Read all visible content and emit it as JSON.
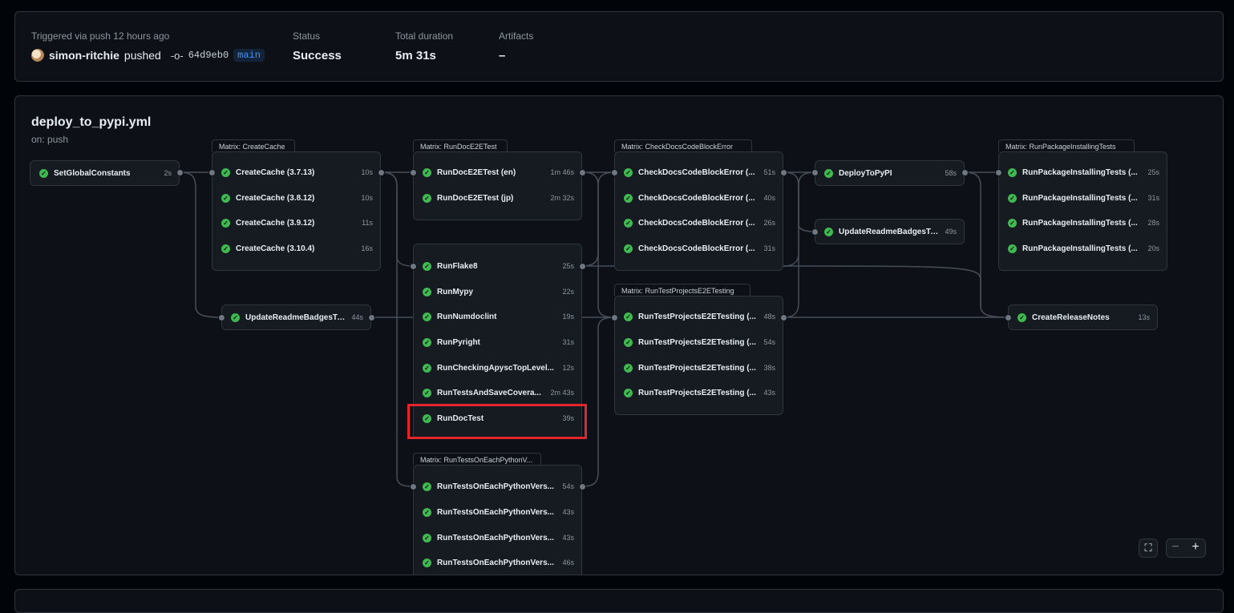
{
  "summary": {
    "trigger_label": "Triggered via push 12 hours ago",
    "actor": "simon-ritchie",
    "verb": "pushed",
    "commit_sha": "64d9eb0",
    "branch": "main",
    "status_label": "Status",
    "status_value": "Success",
    "duration_label": "Total duration",
    "duration_value": "5m 31s",
    "artifacts_label": "Artifacts",
    "artifacts_value": "–"
  },
  "workflow": {
    "file": "deploy_to_pypi.yml",
    "trigger": "on: push"
  },
  "groups": {
    "createcache": "Matrix: CreateCache",
    "rundoc": "Matrix: RunDocE2ETest",
    "checkdocs": "Matrix: CheckDocsCodeBlockError",
    "runpackage": "Matrix: RunPackageInstallingTests",
    "runtestprojects": "Matrix: RunTestProjectsE2ETesting",
    "runtestsonpy": "Matrix: RunTestsOnEachPythonV..."
  },
  "jobs": {
    "setglobal": {
      "name": "SetGlobalConstants",
      "dur": "2s"
    },
    "cc1": {
      "name": "CreateCache (3.7.13)",
      "dur": "10s"
    },
    "cc2": {
      "name": "CreateCache (3.8.12)",
      "dur": "10s"
    },
    "cc3": {
      "name": "CreateCache (3.9.12)",
      "dur": "11s"
    },
    "cc4": {
      "name": "CreateCache (3.10.4)",
      "dur": "16s"
    },
    "urbc": {
      "name": "UpdateReadmeBadgesToCh...",
      "dur": "44s"
    },
    "rd1": {
      "name": "RunDocE2ETest (en)",
      "dur": "1m 46s"
    },
    "rd2": {
      "name": "RunDocE2ETest (jp)",
      "dur": "2m 32s"
    },
    "flake8": {
      "name": "RunFlake8",
      "dur": "25s"
    },
    "mypy": {
      "name": "RunMypy",
      "dur": "22s"
    },
    "numdoc": {
      "name": "RunNumdoclint",
      "dur": "19s"
    },
    "pyright": {
      "name": "RunPyright",
      "dur": "31s"
    },
    "apysc": {
      "name": "RunCheckingApyscTopLevel...",
      "dur": "12s"
    },
    "coverage": {
      "name": "RunTestsAndSaveCovera...",
      "dur": "2m 43s"
    },
    "doctest": {
      "name": "RunDocTest",
      "dur": "39s"
    },
    "py1": {
      "name": "RunTestsOnEachPythonVers...",
      "dur": "54s"
    },
    "py2": {
      "name": "RunTestsOnEachPythonVers...",
      "dur": "43s"
    },
    "py3": {
      "name": "RunTestsOnEachPythonVers...",
      "dur": "43s"
    },
    "py4": {
      "name": "RunTestsOnEachPythonVers...",
      "dur": "46s"
    },
    "cd1": {
      "name": "CheckDocsCodeBlockError (...",
      "dur": "51s"
    },
    "cd2": {
      "name": "CheckDocsCodeBlockError (...",
      "dur": "40s"
    },
    "cd3": {
      "name": "CheckDocsCodeBlockError (...",
      "dur": "26s"
    },
    "cd4": {
      "name": "CheckDocsCodeBlockError (...",
      "dur": "31s"
    },
    "tp1": {
      "name": "RunTestProjectsE2ETesting (...",
      "dur": "48s"
    },
    "tp2": {
      "name": "RunTestProjectsE2ETesting (...",
      "dur": "54s"
    },
    "tp3": {
      "name": "RunTestProjectsE2ETesting (...",
      "dur": "38s"
    },
    "tp4": {
      "name": "RunTestProjectsE2ETesting (...",
      "dur": "43s"
    },
    "deploy": {
      "name": "DeployToPyPI",
      "dur": "58s"
    },
    "urbp": {
      "name": "UpdateReadmeBadgesToPa...",
      "dur": "49s"
    },
    "pk1": {
      "name": "RunPackageInstallingTests (...",
      "dur": "25s"
    },
    "pk2": {
      "name": "RunPackageInstallingTests (...",
      "dur": "31s"
    },
    "pk3": {
      "name": "RunPackageInstallingTests (...",
      "dur": "28s"
    },
    "pk4": {
      "name": "RunPackageInstallingTests (...",
      "dur": "20s"
    },
    "release": {
      "name": "CreateReleaseNotes",
      "dur": "13s"
    }
  },
  "controls": {
    "fullscreen_icon": "fullscreen-icon",
    "zoom_out_icon": "minus-icon",
    "zoom_in_icon": "plus-icon"
  },
  "colors": {
    "success": "#3fb950",
    "highlight": "#e5252a",
    "branch": "#4493f8"
  }
}
